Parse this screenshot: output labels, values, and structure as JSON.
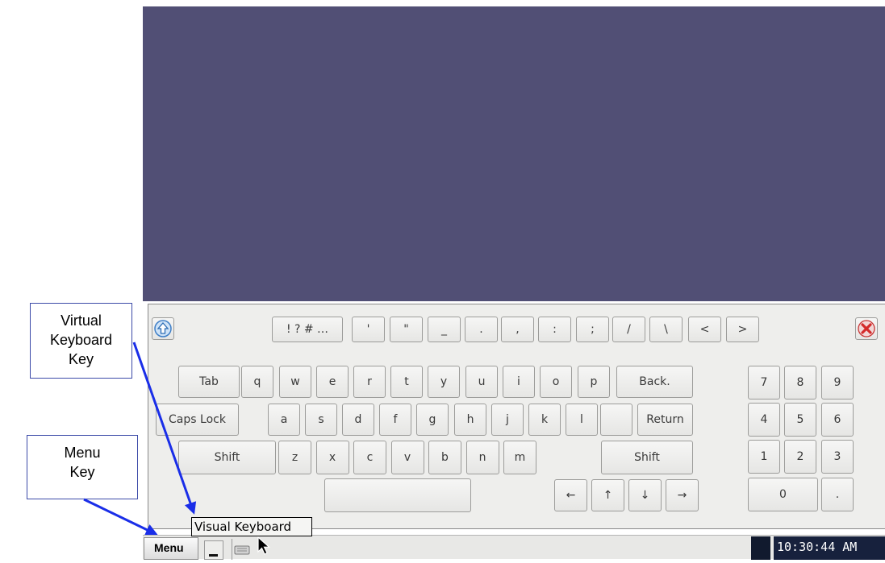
{
  "annotations": {
    "virtual_keyboard_key": "Virtual\nKeyboard\nKey",
    "menu_key": "Menu\nKey"
  },
  "keyboard": {
    "symbol_row": [
      "! ? # …",
      "'",
      "\"",
      "_",
      ".",
      ",",
      ":",
      ";",
      "/",
      "\\",
      "<",
      ">"
    ],
    "row1": [
      "Tab",
      "q",
      "w",
      "e",
      "r",
      "t",
      "y",
      "u",
      "i",
      "o",
      "p",
      "Back."
    ],
    "row2": [
      "Caps Lock",
      "a",
      "s",
      "d",
      "f",
      "g",
      "h",
      "j",
      "k",
      "l",
      "",
      "Return"
    ],
    "row3": [
      "Shift",
      "z",
      "x",
      "c",
      "v",
      "b",
      "n",
      "m",
      "Shift"
    ],
    "arrows": [
      "←",
      "↑",
      "↓",
      "→"
    ],
    "numpad": [
      "7",
      "8",
      "9",
      "4",
      "5",
      "6",
      "1",
      "2",
      "3",
      "0",
      "."
    ]
  },
  "tooltip": "Visual Keyboard",
  "taskbar": {
    "menu_label": "Menu",
    "clock": "10:30:44 AM"
  },
  "colors": {
    "desktop": "#514f75",
    "annotation_arrow": "#1a2ee8"
  }
}
